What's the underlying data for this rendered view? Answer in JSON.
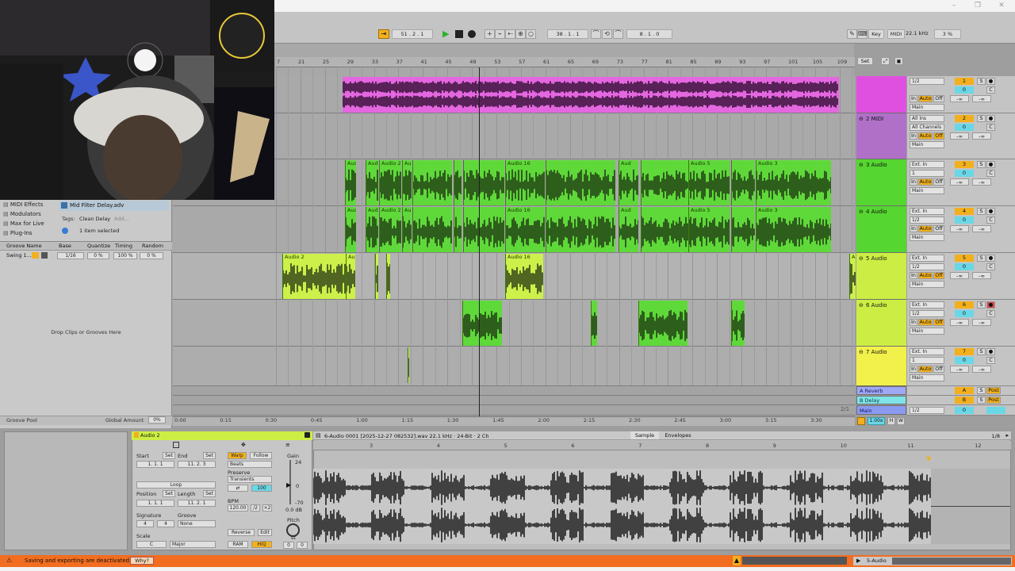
{
  "transport": {
    "position": "51 .  2 .  1",
    "loop_start": "38 .  1 .  1",
    "loop_length": "8 .  1 .  0",
    "key_label": "Key",
    "midi_label": "MIDI",
    "sample_rate": "22.1 kHz",
    "cpu": "3 %"
  },
  "browser": {
    "items": [
      "MIDI Effects",
      "Modulators",
      "Max for Live",
      "Plug-Ins"
    ],
    "selected_file": "Mid Filter Delay.adv",
    "tags_label": "Tags:",
    "tag_value": "Clean Delay",
    "tag_add": "Add...",
    "items_selected": "1 item selected",
    "groove_cols": [
      "Groove Name",
      "Base",
      "Quantize",
      "Timing",
      "Random"
    ],
    "groove_row": [
      "Swing 1...",
      "1/16",
      "0 %",
      "100 %",
      "0 %"
    ],
    "drop_hint": "Drop Clips or Grooves Here",
    "groove_pool": "Groove Pool",
    "global_amount_label": "Global Amount",
    "global_amount_value": "0%"
  },
  "ruler_bars": [
    "7",
    "21",
    "25",
    "29",
    "33",
    "37",
    "41",
    "45",
    "49",
    "53",
    "57",
    "61",
    "65",
    "69",
    "73",
    "77",
    "81",
    "85",
    "89",
    "93",
    "97",
    "101",
    "105",
    "109"
  ],
  "time_labels": [
    "0:00",
    "0:15",
    "0:30",
    "0:45",
    "1:00",
    "1:15",
    "1:30",
    "1:45",
    "2:00",
    "2:15",
    "2:30",
    "2:45",
    "3:00",
    "3:15",
    "3:30"
  ],
  "time_fraction": "2/1",
  "set_label": "Set",
  "tracks": [
    {
      "name": "",
      "num": "1",
      "input": "1/2",
      "route": "Main",
      "color": "#e050e0"
    },
    {
      "name": "2 MIDI",
      "num": "2",
      "input": "All Ins",
      "input2": "All Channels",
      "route": "Main",
      "color": "#b070c8"
    },
    {
      "name": "3 Audio",
      "num": "3",
      "input": "Ext. In",
      "input2": "1",
      "route": "Main",
      "color": "#55d630"
    },
    {
      "name": "4 Audio",
      "num": "4",
      "input": "Ext. In",
      "input2": "1/2",
      "route": "Main",
      "color": "#55d630"
    },
    {
      "name": "5 Audio",
      "num": "5",
      "input": "Ext. In",
      "input2": "1/2",
      "route": "Main",
      "color": "#ccee44"
    },
    {
      "name": "6 Audio",
      "num": "6",
      "input": "Ext. In",
      "input2": "1/2",
      "route": "Main",
      "color": "#ccee44"
    },
    {
      "name": "7 Audio",
      "num": "7",
      "input": "Ext. In",
      "input2": "1",
      "route": "Main",
      "color": "#f2f04a"
    }
  ],
  "returns": [
    {
      "name": "A Reverb",
      "letter": "A",
      "post": "Post"
    },
    {
      "name": "B Delay",
      "letter": "B",
      "post": "Post"
    }
  ],
  "main": {
    "name": "Main",
    "input": "1/2",
    "num": "0",
    "zoom": "1.00x",
    "h": "H",
    "w": "W"
  },
  "io": {
    "in": "In",
    "auto": "Auto",
    "off": "Off",
    "s": "S",
    "c": "C",
    "inf": "-∞",
    "zero": "0"
  },
  "clip_labels": {
    "audio2": "Audio 2",
    "audio16": "Audio 16",
    "audio5": "Audio 5",
    "audio3": "Audio 3",
    "aud": "Aud",
    "au": "Au"
  },
  "clipview": {
    "clip_name": "Audio 2",
    "file_info": "6-Audio 0001 [2025-12-27 082532].wav  22.1 kHz · 24-Bit · 2 Ch",
    "tab_sample": "Sample",
    "tab_envelopes": "Envelopes",
    "page": "1/8",
    "start_label": "Start",
    "set": "Set",
    "end_label": "End",
    "start_val": "1.  1.  1",
    "end_val": "11.  2.  3",
    "loop": "Loop",
    "position_label": "Position",
    "length_label": "Length",
    "position_val": "1.  1.  1",
    "length_val": "11.  2.  1",
    "signature_label": "Signature",
    "groove_label": "Groove",
    "sig_num": "4",
    "sig_den": "4",
    "groove_val": "None",
    "scale_label": "Scale",
    "scale_root": "C",
    "scale_mode": "Major",
    "warp": "Warp",
    "follow": "Follow",
    "beats": "Beats",
    "preserve": "Preserve",
    "transients": "Transients",
    "env_val": "100",
    "bpm_label": "BPM",
    "bpm": "120.00",
    "half": "/2",
    "double": "×2",
    "reverse": "Reverse",
    "edit": "Edit",
    "ram": "RAM",
    "hiq": "HiQ",
    "gain_label": "Gain",
    "gain_top": "24",
    "gain_mid": "0",
    "gain_bot": "-70",
    "gain_val": "0.0 dB",
    "pitch_label": "Pitch",
    "pitch_unit": "st",
    "pitch_a": "0",
    "pitch_b": "0",
    "beat_marks": [
      "3",
      "4",
      "5",
      "6",
      "7",
      "8",
      "9",
      "10",
      "11",
      "12"
    ]
  },
  "status": {
    "message": "Saving and exporting are deactivated.",
    "why": "Why?",
    "track_label": "5-Audio"
  }
}
